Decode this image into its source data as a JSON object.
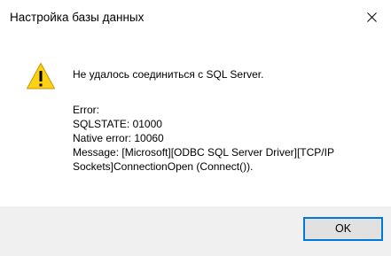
{
  "window": {
    "title": "Настройка базы данных",
    "close_icon": "close-icon"
  },
  "dialog": {
    "icon": "warning-icon",
    "message": "Не удалось соединиться с SQL Server.",
    "details": {
      "error_label": "Error:",
      "sqlstate": "SQLSTATE: 01000",
      "native_error": "Native error: 10060",
      "message": "Message: [Microsoft][ODBC SQL Server Driver][TCP/IP Sockets]ConnectionOpen (Connect())."
    }
  },
  "footer": {
    "ok_label": "OK"
  },
  "colors": {
    "warning_fill": "#fcd116",
    "accent": "#0078d7",
    "footer_bg": "#f0f0f0"
  }
}
